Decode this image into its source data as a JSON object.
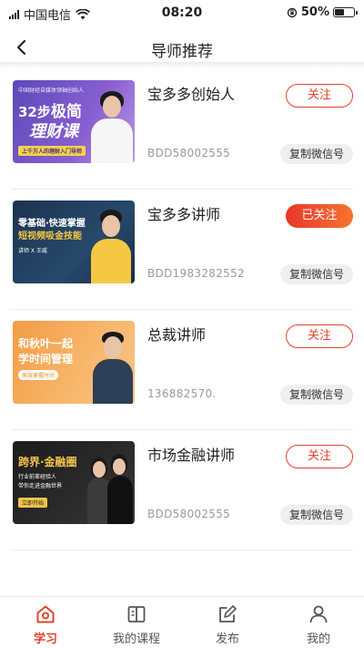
{
  "status_bar": {
    "carrier": "中国电信",
    "time": "08:20",
    "battery": "50%"
  },
  "nav": {
    "title": "导师推荐"
  },
  "mentors": [
    {
      "name": "宝多多创始人",
      "id": "BDD58002555",
      "follow_label": "关注",
      "followed": false,
      "copy_label": "复制微信号",
      "thumb": {
        "top": "中国财经自媒体领袖创始人",
        "big1": "32步",
        "big2": "极简",
        "big3": "理财课",
        "sub": "上千万人的理财入门导师"
      }
    },
    {
      "name": "宝多多讲师",
      "id": "BDD1983282552",
      "follow_label": "已关注",
      "followed": true,
      "copy_label": "复制微信号",
      "thumb": {
        "line1": "零基础·快速掌握",
        "line2": "短视频吸金技能",
        "sub": "讲师 X 王威"
      }
    },
    {
      "name": "总裁讲师",
      "id": "136882570.",
      "follow_label": "关注",
      "followed": false,
      "copy_label": "复制微信号",
      "thumb": {
        "line1": "和秋叶一起",
        "line2": "学时间管理",
        "sub": "高效掌握时间"
      }
    },
    {
      "name": "市场金融讲师",
      "id": "BDD58002555",
      "follow_label": "关注",
      "followed": false,
      "copy_label": "复制微信号",
      "thumb": {
        "line1": "跨界·金融圈",
        "line2": "行业前辈经验人",
        "line3": "带你走进金融世界",
        "sub": "立即开始"
      }
    }
  ],
  "tabs": [
    {
      "label": "学习",
      "icon": "home-icon",
      "active": true
    },
    {
      "label": "我的课程",
      "icon": "book-icon",
      "active": false
    },
    {
      "label": "发布",
      "icon": "edit-icon",
      "active": false
    },
    {
      "label": "我的",
      "icon": "user-icon",
      "active": false
    }
  ],
  "colors": {
    "accent": "#e0442c",
    "accent_gradient_end": "#f7742f"
  }
}
